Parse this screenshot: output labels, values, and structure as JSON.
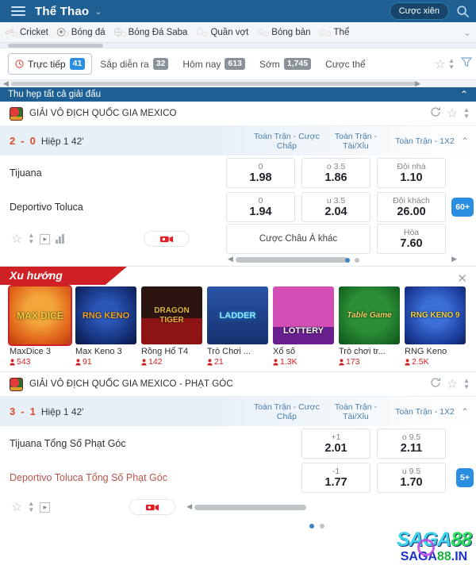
{
  "topbar": {
    "title": "Thể Thao",
    "menu_icon": "hamburger-icon",
    "caret": "⌄",
    "parlay_label": "Cược xiên",
    "search_icon": "search-icon"
  },
  "sportnav": {
    "items": [
      {
        "label": "Cricket",
        "icon": "cricket-icon"
      },
      {
        "label": "Bóng đá",
        "icon": "soccer-ball-icon"
      },
      {
        "label": "Bóng Đá Saba",
        "icon": "saba-soccer-icon"
      },
      {
        "label": "Quần vợt",
        "icon": "tennis-icon"
      },
      {
        "label": "Bóng bàn",
        "icon": "table-tennis-icon"
      },
      {
        "label": "Thể",
        "icon": "esports-icon"
      }
    ],
    "expand_icon": "chevron-down-icon"
  },
  "filters": {
    "tabs": [
      {
        "label": "Trực tiếp",
        "count": "41",
        "active": true,
        "badge_style": "blue"
      },
      {
        "label": "Sắp diễn ra",
        "count": "32",
        "active": false,
        "badge_style": "grey"
      },
      {
        "label": "Hôm nay",
        "count": "613",
        "active": false,
        "badge_style": "grey"
      },
      {
        "label": "Sớm",
        "count": "1,745",
        "active": false,
        "badge_style": "grey"
      },
      {
        "label": "Cược thể",
        "count": "",
        "active": false,
        "badge_style": "none"
      }
    ],
    "favorite_icon": "star-outline-icon",
    "stepper_icon": "spinner-arrows-icon",
    "filter_icon": "funnel-icon"
  },
  "collapse_bar": {
    "label": "Thu hẹp tất cả giải đấu",
    "icon": "chevron-up-icon"
  },
  "matches": [
    {
      "league": "GIẢI VÔ ĐỊCH QUỐC GIA MEXICO",
      "league_icon": "mexico-league-badge",
      "refresh_icon": "refresh-icon",
      "favorite_icon": "star-outline-icon",
      "stepper_icon": "spinner-arrows-icon",
      "score_home": "2",
      "score_sep": "-",
      "score_away": "0",
      "period": "Hiệp 1 42'",
      "market_headers": [
        "Toàn Trận - Cược Chấp",
        "Toàn Trận - Tài/Xỉu",
        "Toàn Trận - 1X2"
      ],
      "collapse_icon": "chevron-up-icon",
      "home_team": "Tijuana",
      "away_team": "Deportivo Toluca",
      "odds_home": [
        {
          "handicap": "0",
          "price": "1.98"
        },
        {
          "handicap": "o 3.5",
          "price": "1.86"
        },
        {
          "handicap": "Đội nhà",
          "price": "1.10"
        }
      ],
      "odds_away": [
        {
          "handicap": "0",
          "price": "1.94"
        },
        {
          "handicap": "u 3.5",
          "price": "2.04"
        },
        {
          "handicap": "Đội khách",
          "price": "26.00"
        }
      ],
      "more_badge": "60+",
      "other_asian_label": "Cược Châu Á khác",
      "draw_label": "Hòa",
      "draw_price": "7.60",
      "video_icon": "live-video-icon",
      "footer_icons": [
        "star-outline-icon",
        "spinner-arrows-icon",
        "play-box-icon",
        "stats-bars-icon"
      ]
    },
    {
      "league": "GIẢI VÔ ĐỊCH QUỐC GIA MEXICO - PHẠT GÓC",
      "league_icon": "mexico-league-badge",
      "refresh_icon": "refresh-icon",
      "favorite_icon": "star-outline-icon",
      "stepper_icon": "spinner-arrows-icon",
      "score_home": "3",
      "score_sep": "-",
      "score_away": "1",
      "period": "Hiệp 1 42'",
      "market_headers": [
        "Toàn Trận - Cược Chấp",
        "Toàn Trận - Tài/Xỉu",
        "Toàn Trận - 1X2"
      ],
      "collapse_icon": "chevron-up-icon",
      "home_team": "Tijuana Tổng Số Phạt Góc",
      "away_team": "Deportivo Toluca Tổng Số Phạt Góc",
      "odds_home": [
        {
          "handicap": "+1",
          "price": "2.01"
        },
        {
          "handicap": "o 9.5",
          "price": "2.11"
        }
      ],
      "odds_away": [
        {
          "handicap": "-1",
          "price": "1.77"
        },
        {
          "handicap": "u 9.5",
          "price": "1.70"
        }
      ],
      "more_badge": "5+",
      "video_icon": "live-video-icon",
      "footer_icons": [
        "star-outline-icon",
        "spinner-arrows-icon",
        "play-box-icon"
      ]
    }
  ],
  "trending": {
    "ribbon_label": "Xu hướng",
    "close_icon": "close-icon",
    "games": [
      {
        "name": "MaxDice 3",
        "players": "543",
        "art_text": "MAX DICE",
        "bg": "#e07718",
        "fg": "#f4d23a",
        "selected": true
      },
      {
        "name": "Max Keno 3",
        "players": "91",
        "art_text": "RNG KENO",
        "bg": "#12235e",
        "fg": "#f2a32b",
        "selected": false
      },
      {
        "name": "Rồng Hổ T4",
        "players": "142",
        "art_text": "DRAGON TIGER",
        "bg": "#2b1410",
        "fg": "#e3b53a",
        "selected": false
      },
      {
        "name": "Trò Chơi ...",
        "players": "21",
        "art_text": "LADDER",
        "bg": "#1b3f86",
        "fg": "#9fe4f7",
        "selected": false
      },
      {
        "name": "Xổ số",
        "players": "1.3K",
        "art_text": "LOTTERY",
        "bg": "#c43faa",
        "fg": "#ffffff",
        "selected": false
      },
      {
        "name": "Trò chơi tr...",
        "players": "173",
        "art_text": "Table Game",
        "bg": "#17601f",
        "fg": "#f3d169",
        "selected": false
      },
      {
        "name": "RNG Keno",
        "players": "2.5K",
        "art_text": "RNG KENO 9",
        "bg": "#1c3f9c",
        "fg": "#f5d33e",
        "selected": false
      }
    ],
    "player_icon": "person-icon"
  },
  "watermark": {
    "line1_a": "SAGA",
    "line1_b": "88",
    "line2_a": "SAGA",
    "line2_b": "88",
    "line2_c": ".IN"
  },
  "colors": {
    "header_blue": "#1f6094",
    "accent_blue": "#2a8fe0",
    "score_red": "#d94b2a",
    "ribbon_red": "#cf2026",
    "market_link": "#4a7ea8"
  }
}
